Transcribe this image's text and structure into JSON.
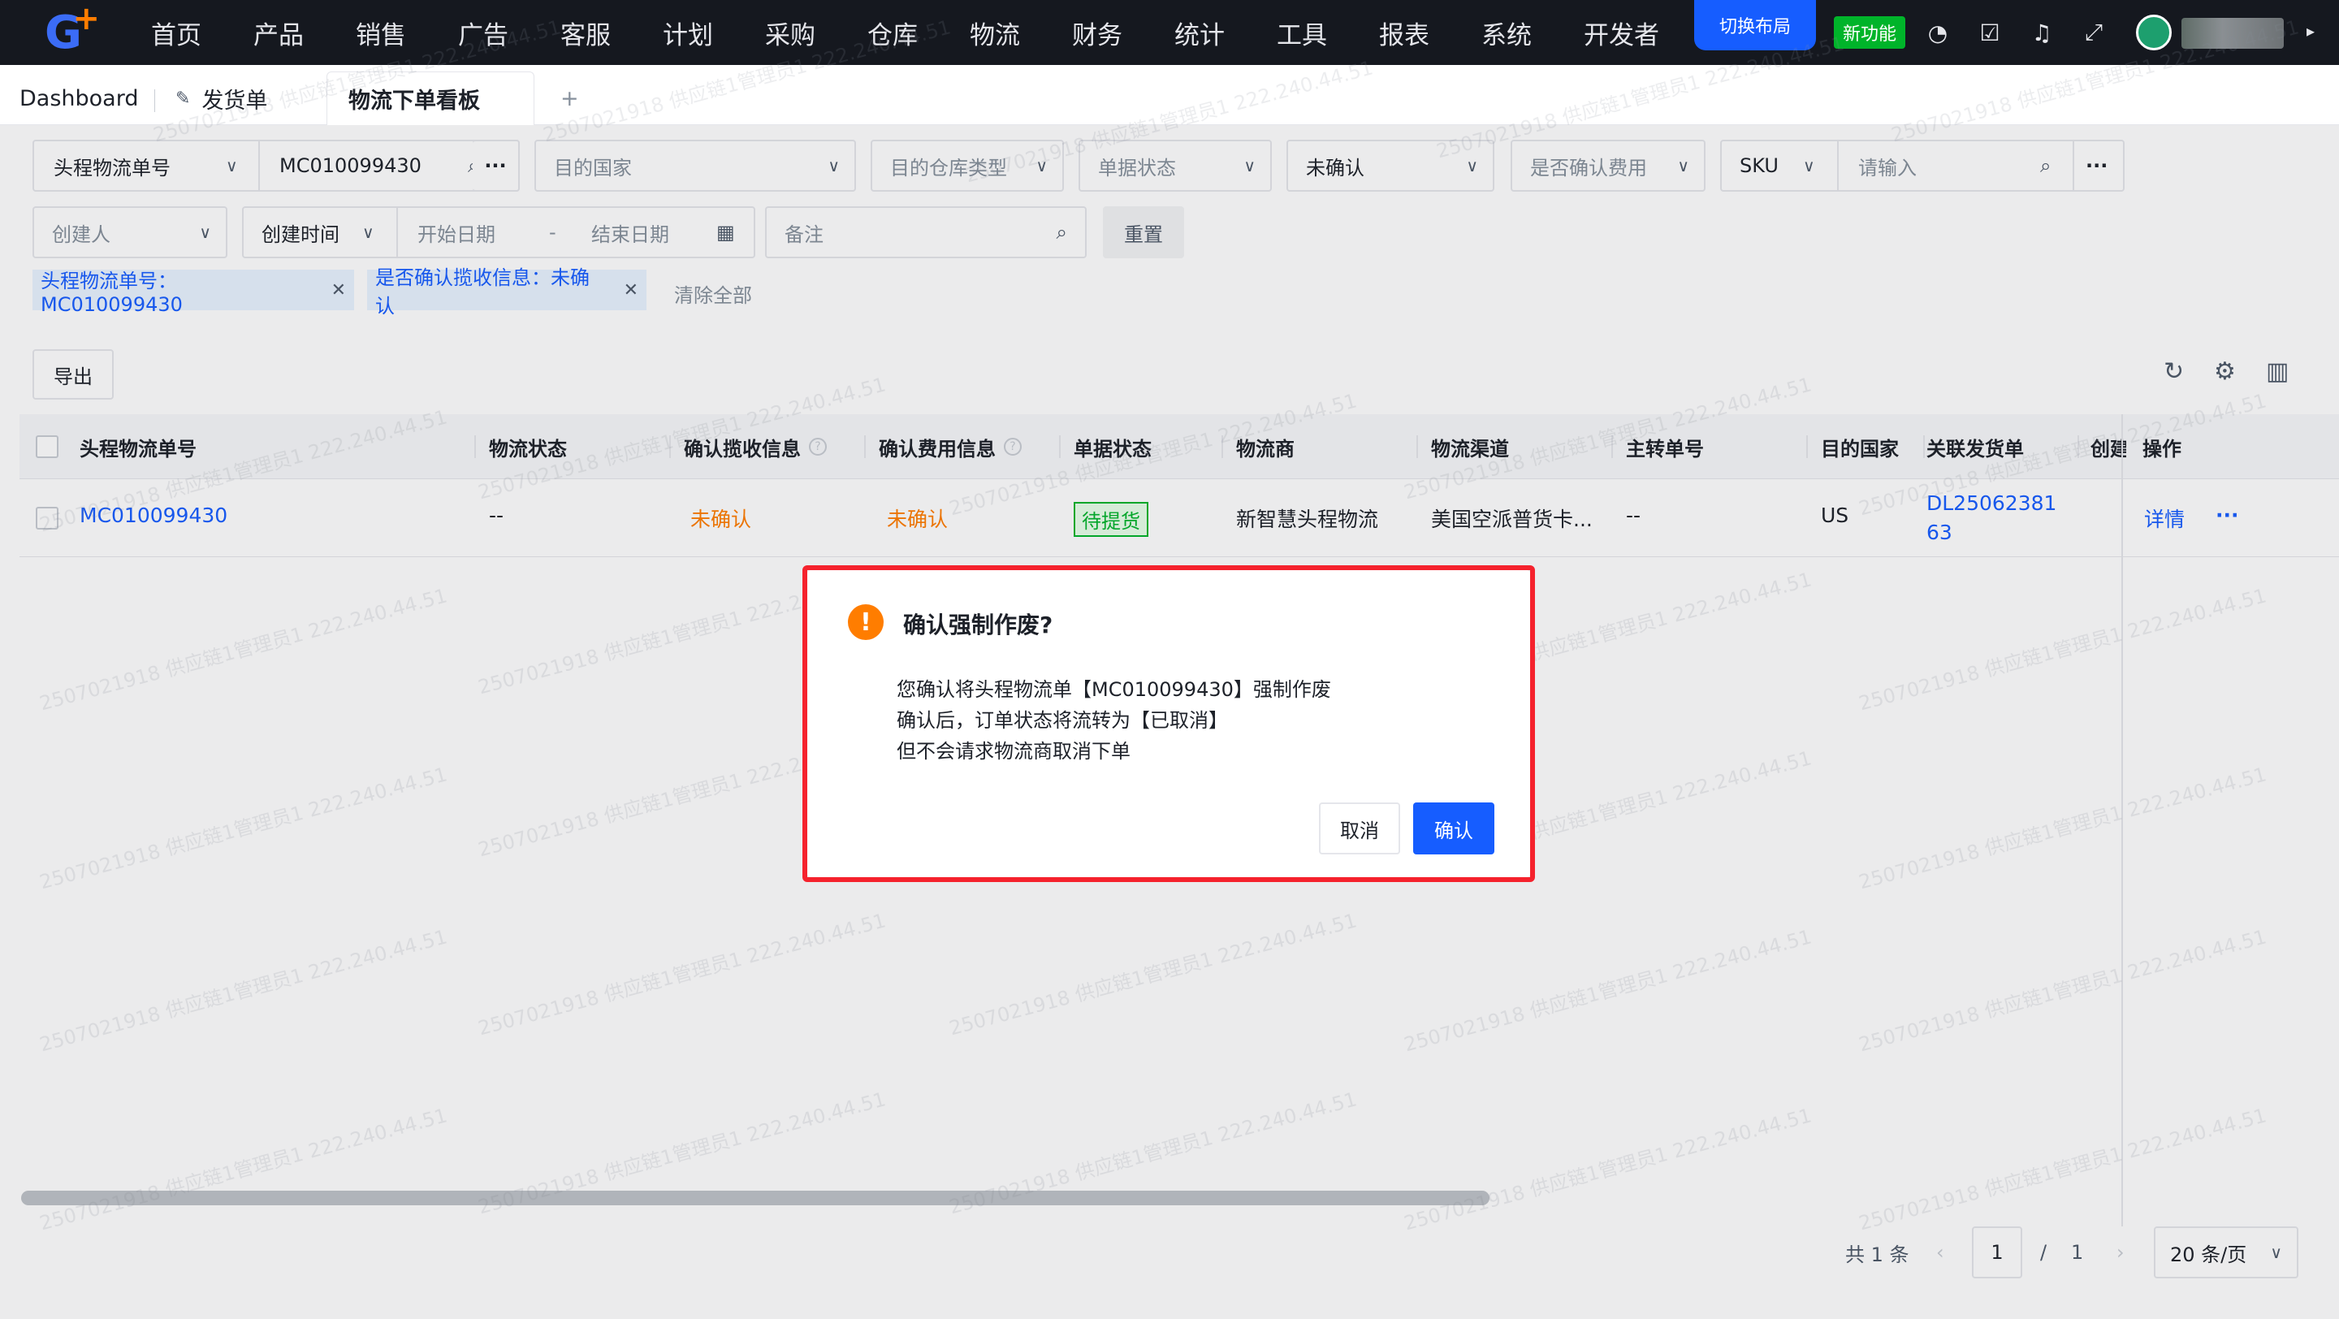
{
  "topbar": {
    "nav": [
      "首页",
      "产品",
      "销售",
      "广告",
      "客服",
      "计划",
      "采购",
      "仓库",
      "物流",
      "财务",
      "统计",
      "工具",
      "报表",
      "系统",
      "开发者"
    ],
    "switch_layout": "切换布局",
    "new_feature": "新功能"
  },
  "tabs": {
    "dashboard": "Dashboard",
    "shipment": "发货单",
    "active": "物流下单看板",
    "add": "+"
  },
  "filters": {
    "field1_label": "头程物流单号",
    "field1_value": "MC010099430",
    "country_placeholder": "目的国家",
    "warehouse_type_placeholder": "目的仓库类型",
    "doc_status_placeholder": "单据状态",
    "confirm_value": "未确认",
    "fee_confirm_placeholder": "是否确认费用",
    "sku_label": "SKU",
    "sku_placeholder": "请输入",
    "creator_placeholder": "创建人",
    "time_label": "创建时间",
    "start_placeholder": "开始日期",
    "range_sep": "-",
    "end_placeholder": "结束日期",
    "remark_placeholder": "备注",
    "reset": "重置",
    "more": "···"
  },
  "active_tags": [
    "头程物流单号：MC010099430",
    "是否确认揽收信息：未确认"
  ],
  "clear_all": "清除全部",
  "toolbar": {
    "export": "导出"
  },
  "table": {
    "headers": [
      "头程物流单号",
      "物流状态",
      "确认揽收信息",
      "确认费用信息",
      "单据状态",
      "物流商",
      "物流渠道",
      "主转单号",
      "目的国家",
      "关联发货单",
      "创建",
      "操作"
    ],
    "row": {
      "tracking_no": "MC010099430",
      "logistics_status": "--",
      "pickup_confirm": "未确认",
      "fee_confirm": "未确认",
      "doc_status": "待提货",
      "carrier": "新智慧头程物流",
      "channel": "美国空派普货卡...",
      "master_no": "--",
      "country": "US",
      "related_line1": "DL25062381",
      "related_line2": "63",
      "detail": "详情",
      "more": "···"
    }
  },
  "pagination": {
    "total": "共 1 条",
    "current": "1",
    "slash": "/",
    "pages": "1",
    "page_size": "20 条/页"
  },
  "watermark": "2507021918 供应链1管理员1 222.240.44.51",
  "modal": {
    "title": "确认强制作废?",
    "line1": "您确认将头程物流单【MC010099430】强制作废",
    "line2": "确认后，订单状态将流转为【已取消】",
    "line3": "但不会请求物流商取消下单",
    "cancel": "取消",
    "confirm": "确认"
  },
  "colors": {
    "primary": "#165dff",
    "topbar": "#15181f",
    "warning": "#ff7d00",
    "success": "#00b42a",
    "highlight_border": "#f5222d"
  }
}
